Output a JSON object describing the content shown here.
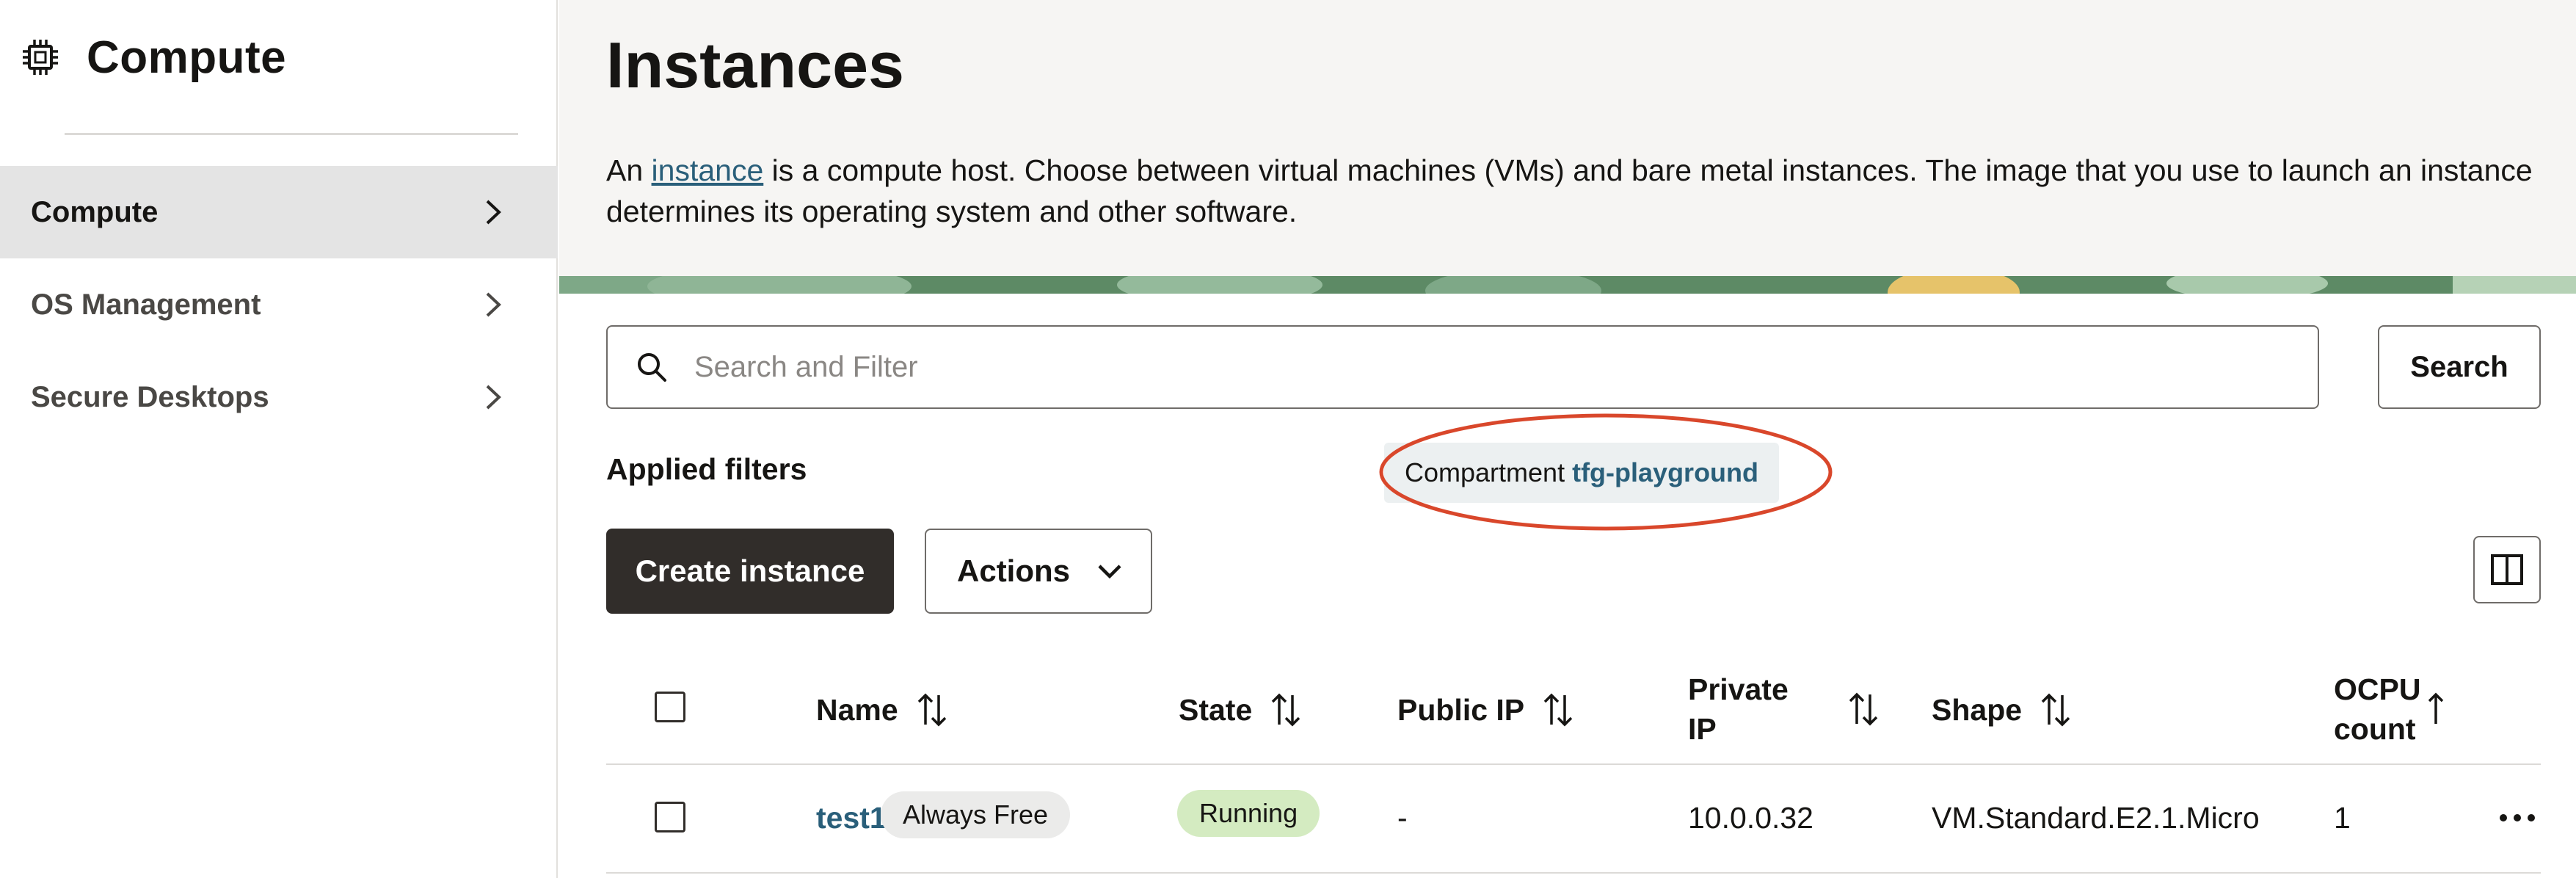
{
  "sidebar": {
    "title": "Compute",
    "icon": "chip-icon",
    "items": [
      {
        "label": "Compute",
        "active": true
      },
      {
        "label": "OS Management",
        "active": false
      },
      {
        "label": "Secure Desktops",
        "active": false
      }
    ]
  },
  "page": {
    "title": "Instances",
    "description_prefix": "An ",
    "description_link": "instance",
    "description_suffix": " is a compute host. Choose between virtual machines (VMs) and bare metal instances. The image that you use to launch an instance determines its operating system and other software."
  },
  "search": {
    "placeholder": "Search and Filter",
    "value": "",
    "button_label": "Search"
  },
  "filters": {
    "label": "Applied filters",
    "chips": [
      {
        "key": "Compartment",
        "value": "tfg-playground"
      }
    ]
  },
  "toolbar": {
    "create_label": "Create instance",
    "actions_label": "Actions"
  },
  "table": {
    "columns": {
      "name": "Name",
      "state": "State",
      "public_ip": "Public IP",
      "private_ip_line1": "Private",
      "private_ip_line2": "IP",
      "shape": "Shape",
      "ocpu_line1": "OCPU",
      "ocpu_line2": "count"
    },
    "rows": [
      {
        "name": "test123",
        "badge": "Always Free",
        "state": "Running",
        "public_ip": "-",
        "private_ip": "10.0.0.32",
        "shape": "VM.Standard.E2.1.Micro",
        "ocpu": "1",
        "menu": "⋯"
      }
    ]
  },
  "colors": {
    "primary_button": "#312d2a",
    "link": "#2a5f7a",
    "running_badge": "#d4ebc1",
    "annotation_ring": "#d9472b",
    "hero_bg": "#f6f5f3"
  }
}
